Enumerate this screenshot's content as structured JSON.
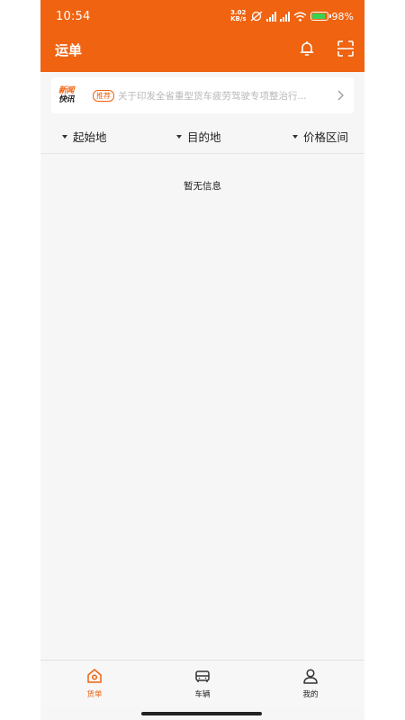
{
  "status_bar": {
    "time": "10:54",
    "net_speed_value": "3.02",
    "net_speed_unit": "KB/s",
    "battery_text": "98%"
  },
  "header": {
    "title": "运单",
    "icons": [
      "bell-icon",
      "scan-icon"
    ],
    "color": "#ef6311"
  },
  "news": {
    "logo_line1": "新闻",
    "logo_line2": "快讯",
    "tag": "推荐",
    "headline": "关于印发全省重型货车疲劳驾驶专项整治行..."
  },
  "filters": [
    {
      "label": "起始地"
    },
    {
      "label": "目的地"
    },
    {
      "label": "价格区间"
    }
  ],
  "empty_message": "暂无信息",
  "tabbar": {
    "tabs": [
      {
        "label": "货单",
        "icon": "home-icon",
        "active": true
      },
      {
        "label": "车辆",
        "icon": "car-icon",
        "active": false
      },
      {
        "label": "我的",
        "icon": "user-icon",
        "active": false
      }
    ]
  }
}
